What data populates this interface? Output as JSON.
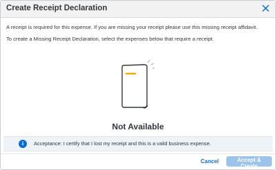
{
  "dialog": {
    "title": "Create Receipt Declaration",
    "close_icon": "close-icon"
  },
  "body": {
    "intro_line1": "A receipt is required for this expense. If you are missing your receipt please use this missing receipt affidavit.",
    "intro_line2": "To create a Missing Receipt Declaration, select the expenses below that require a receipt.",
    "illustration_icon": "document-illustration-icon",
    "empty_state": "Not Available"
  },
  "acknowledgement": {
    "icon": "info-icon",
    "icon_glyph": "i",
    "text": "Acceptance: I certify that I lost my receipt and this is a valid business expense."
  },
  "footer": {
    "cancel_label": "Cancel",
    "accept_label": "Accept & Create"
  },
  "colors": {
    "accent": "#0a6ed1",
    "accept_disabled": "#9cc3ea",
    "illustration_highlight": "#f0ab00",
    "header_bg": "#f2f2f2",
    "ack_bg": "#eef3f8"
  }
}
